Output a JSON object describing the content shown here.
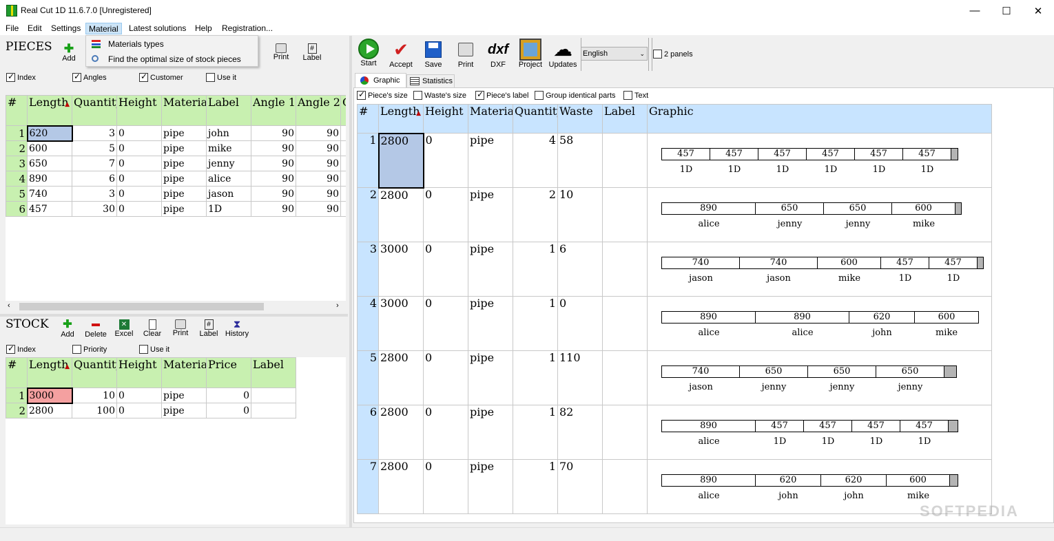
{
  "window": {
    "title": "Real Cut 1D 11.6.7.0 [Unregistered]",
    "minimize": "—",
    "maximize": "☐",
    "close": "✕"
  },
  "menu": [
    "File",
    "Edit",
    "Settings",
    "Material",
    "Latest solutions",
    "Help",
    "Registration..."
  ],
  "dropdown": [
    "Materials types",
    "Find the optimal size of stock pieces"
  ],
  "pieces": {
    "title": "PIECES",
    "toolbar": {
      "add": "Add",
      "print": "Print",
      "label": "Label"
    },
    "options": [
      "Index",
      "Angles",
      "Customer",
      "Use it"
    ],
    "headers": [
      "#",
      "Length",
      "Quantity",
      "Height",
      "Material",
      "Label",
      "Angle 1",
      "Angle 2",
      "C"
    ],
    "rows": [
      [
        "1",
        "620",
        "3",
        "0",
        "pipe",
        "john",
        "90",
        "90"
      ],
      [
        "2",
        "600",
        "5",
        "0",
        "pipe",
        "mike",
        "90",
        "90"
      ],
      [
        "3",
        "650",
        "7",
        "0",
        "pipe",
        "jenny",
        "90",
        "90"
      ],
      [
        "4",
        "890",
        "6",
        "0",
        "pipe",
        "alice",
        "90",
        "90"
      ],
      [
        "5",
        "740",
        "3",
        "0",
        "pipe",
        "jason",
        "90",
        "90"
      ],
      [
        "6",
        "457",
        "30",
        "0",
        "pipe",
        "1D",
        "90",
        "90"
      ]
    ]
  },
  "stock": {
    "title": "STOCK",
    "toolbar": {
      "add": "Add",
      "delete": "Delete",
      "excel": "Excel",
      "clear": "Clear",
      "print": "Print",
      "label": "Label",
      "history": "History"
    },
    "options": [
      "Index",
      "Priority",
      "Use it"
    ],
    "headers": [
      "#",
      "Length",
      "Quantity",
      "Height",
      "Material",
      "Price",
      "Label"
    ],
    "rows": [
      [
        "1",
        "3000",
        "10",
        "0",
        "pipe",
        "0",
        ""
      ],
      [
        "2",
        "2800",
        "100",
        "0",
        "pipe",
        "0",
        ""
      ]
    ]
  },
  "right_toolbar": {
    "start": "Start",
    "accept": "Accept",
    "save": "Save",
    "print": "Print",
    "dxf": "DXF",
    "dxf_glyph": "dxf",
    "project": "Project",
    "updates": "Updates",
    "language": "English",
    "two_panels": "2 panels"
  },
  "tabs": [
    "Graphic",
    "Statistics"
  ],
  "view_options": [
    "Piece's size",
    "Waste's size",
    "Piece's label",
    "Group identical parts",
    "Text"
  ],
  "result": {
    "headers": [
      "#",
      "Length",
      "Height",
      "Material",
      "Quantity",
      "Waste",
      "Label",
      "Graphic"
    ],
    "rows": [
      {
        "n": "1",
        "length": "2800",
        "height": "0",
        "material": "pipe",
        "qty": "4",
        "waste": "58",
        "pieces": [
          [
            "457",
            "1D"
          ],
          [
            "457",
            "1D"
          ],
          [
            "457",
            "1D"
          ],
          [
            "457",
            "1D"
          ],
          [
            "457",
            "1D"
          ],
          [
            "457",
            "1D"
          ]
        ],
        "waste_val": 58,
        "stock": 2800
      },
      {
        "n": "2",
        "length": "2800",
        "height": "0",
        "material": "pipe",
        "qty": "2",
        "waste": "10",
        "pieces": [
          [
            "890",
            "alice"
          ],
          [
            "650",
            "jenny"
          ],
          [
            "650",
            "jenny"
          ],
          [
            "600",
            "mike"
          ]
        ],
        "waste_val": 10,
        "stock": 2800
      },
      {
        "n": "3",
        "length": "3000",
        "height": "0",
        "material": "pipe",
        "qty": "1",
        "waste": "6",
        "pieces": [
          [
            "740",
            "jason"
          ],
          [
            "740",
            "jason"
          ],
          [
            "600",
            "mike"
          ],
          [
            "457",
            "1D"
          ],
          [
            "457",
            "1D"
          ]
        ],
        "waste_val": 6,
        "stock": 3000
      },
      {
        "n": "4",
        "length": "3000",
        "height": "0",
        "material": "pipe",
        "qty": "1",
        "waste": "0",
        "pieces": [
          [
            "890",
            "alice"
          ],
          [
            "890",
            "alice"
          ],
          [
            "620",
            "john"
          ],
          [
            "600",
            "mike"
          ]
        ],
        "waste_val": 0,
        "stock": 3000
      },
      {
        "n": "5",
        "length": "2800",
        "height": "0",
        "material": "pipe",
        "qty": "1",
        "waste": "110",
        "pieces": [
          [
            "740",
            "jason"
          ],
          [
            "650",
            "jenny"
          ],
          [
            "650",
            "jenny"
          ],
          [
            "650",
            "jenny"
          ]
        ],
        "waste_val": 110,
        "stock": 2800
      },
      {
        "n": "6",
        "length": "2800",
        "height": "0",
        "material": "pipe",
        "qty": "1",
        "waste": "82",
        "pieces": [
          [
            "890",
            "alice"
          ],
          [
            "457",
            "1D"
          ],
          [
            "457",
            "1D"
          ],
          [
            "457",
            "1D"
          ],
          [
            "457",
            "1D"
          ]
        ],
        "waste_val": 82,
        "stock": 2800
      },
      {
        "n": "7",
        "length": "2800",
        "height": "0",
        "material": "pipe",
        "qty": "1",
        "waste": "70",
        "pieces": [
          [
            "890",
            "alice"
          ],
          [
            "620",
            "john"
          ],
          [
            "620",
            "john"
          ],
          [
            "600",
            "mike"
          ]
        ],
        "waste_val": 70,
        "stock": 2800
      }
    ]
  },
  "watermark": "SOFTPEDIA"
}
